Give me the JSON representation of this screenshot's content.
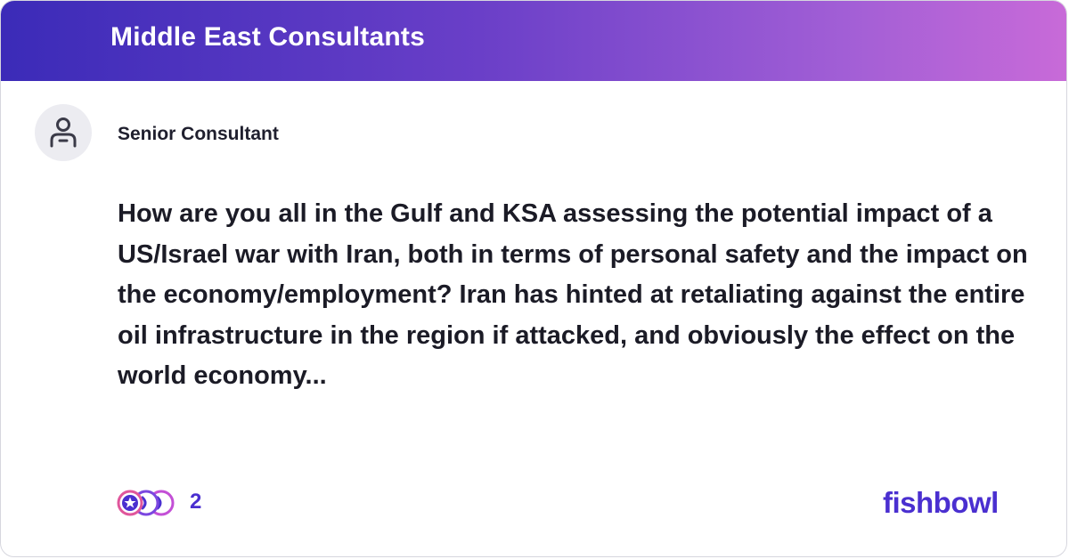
{
  "header": {
    "title": "Middle East Consultants"
  },
  "post": {
    "author": "Senior Consultant",
    "question": "How are you all in the Gulf and KSA assessing the potential impact of a US/Israel war with Iran, both in terms of personal safety and the impact on the economy/employment? Iran has hinted at retaliating against the entire oil infrastructure in the region if attacked, and obviously the effect on the world economy..."
  },
  "footer": {
    "reaction_count": "2",
    "logo": "fishbowl"
  },
  "colors": {
    "banner_start": "#3b2bb8",
    "banner_end": "#c86ad8",
    "brand": "#4a2fd0"
  },
  "icons": {
    "avatar": "user-icon",
    "reactions": "reactions-icon"
  }
}
